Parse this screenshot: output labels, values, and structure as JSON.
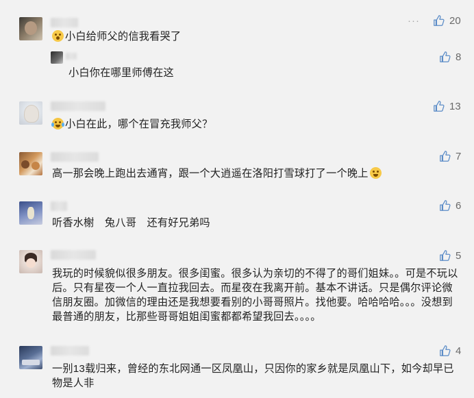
{
  "comments": [
    {
      "text": "小白给师父的信我看哭了",
      "emoji": "shocked-face-icon",
      "likes": "20",
      "more": "···",
      "reply": {
        "text": "小白你在哪里师傅在这",
        "likes": "8"
      }
    },
    {
      "text": "小白在此，哪个在冒充我师父？",
      "emoji": "tears-of-joy-icon",
      "likes": "13"
    },
    {
      "text": "高一那会晚上跑出去通宵，跟一个大逍遥在洛阳打雪球打了一个晚上",
      "emoji": "grinning-sweat-icon",
      "likes": "7"
    },
    {
      "text": "听香水榭　兔八哥　还有好兄弟吗",
      "likes": "6"
    },
    {
      "text": "我玩的时候貌似很多朋友。很多闺蜜。很多认为亲切的不得了的哥们姐妹。。可是不玩以后。只有星夜一个人一直拉我回去。而星夜在我离开前。基本不讲话。只是偶尔评论微信朋友圈。加微信的理由还是我想要看别的小哥哥照片。找他要。哈哈哈哈。。。没想到最普通的朋友，比那些哥哥姐姐闺蜜都都希望我回去。。。。",
      "likes": "5"
    },
    {
      "text": "一别13载归来，曾经的东北网通一区凤凰山，只因你的家乡就是凤凰山下，如今却早已物是人非",
      "likes": "4"
    }
  ],
  "colors": {
    "background": "#f2f2f2",
    "text": "#222222",
    "like": "#6a6a6a",
    "like_icon": "#5b8cc7"
  }
}
